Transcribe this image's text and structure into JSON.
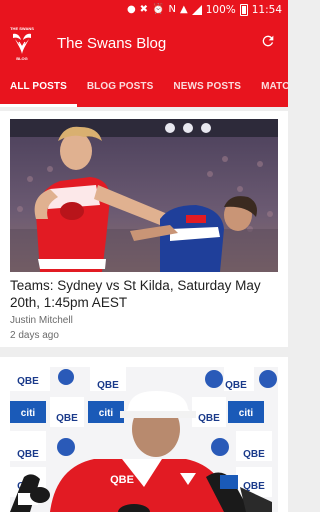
{
  "status_bar": {
    "battery": "100%",
    "time": "11:54"
  },
  "app_bar": {
    "logo_top_text": "THE SWANS",
    "logo_bottom_text": "BLOG",
    "title": "The Swans Blog",
    "refresh_icon": "refresh-icon"
  },
  "tabs": [
    {
      "label": "ALL POSTS",
      "active": true
    },
    {
      "label": "BLOG POSTS",
      "active": false
    },
    {
      "label": "NEWS POSTS",
      "active": false
    },
    {
      "label": "MATCHES AND",
      "active": false
    }
  ],
  "posts": [
    {
      "headline": "Teams: Sydney vs St Kilda, Saturday May 20th, 1:45pm AEST",
      "author": "Justin Mitchell",
      "date": "2 days ago",
      "image": "football-tackle-photo"
    },
    {
      "image": "press-conference-photo",
      "sponsor_labels": [
        "QBE",
        "citi"
      ],
      "jersey_text": "QBE"
    }
  ],
  "colors": {
    "primary": "#e8141e",
    "text": "#1f1f1f",
    "meta": "#6b6b6b",
    "background": "#eeeeee"
  }
}
